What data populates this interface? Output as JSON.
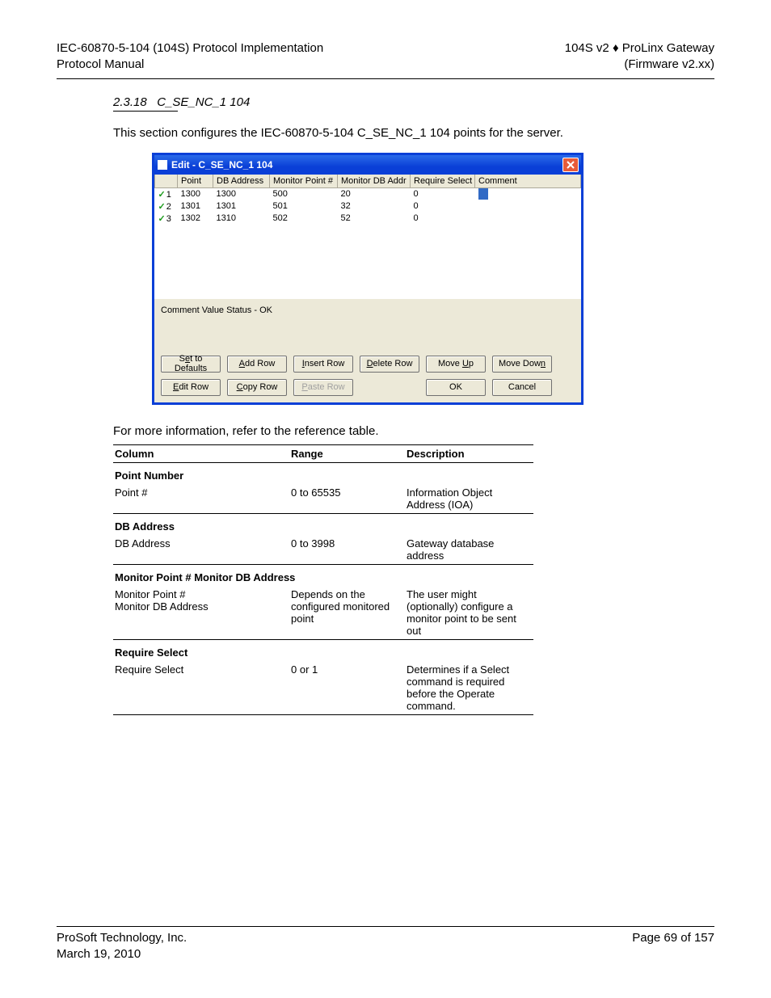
{
  "header": {
    "left1": "IEC-60870-5-104 (104S) Protocol Implementation",
    "left2": "Protocol Manual",
    "right1": "104S v2 ♦ ProLinx Gateway",
    "right2": "(Firmware v2.xx)"
  },
  "section": {
    "number": "2.3.18",
    "title": "C_SE_NC_1 104",
    "intro": "This section configures the IEC-60870-5-104 C_SE_NC_1 104 points for the server."
  },
  "dialog": {
    "title": "Edit - C_SE_NC_1 104",
    "columns": [
      "",
      "Point",
      "DB Address",
      "Monitor Point #",
      "Monitor DB Addr",
      "Require Select",
      "Comment"
    ],
    "rows": [
      {
        "n": "1",
        "point": "1300",
        "db": "1300",
        "mpt": "500",
        "mdb": "20",
        "req": "0"
      },
      {
        "n": "2",
        "point": "1301",
        "db": "1301",
        "mpt": "501",
        "mdb": "32",
        "req": "0"
      },
      {
        "n": "3",
        "point": "1302",
        "db": "1310",
        "mpt": "502",
        "mdb": "52",
        "req": "0"
      }
    ],
    "status": "Comment Value Status - OK",
    "buttons": {
      "set_defaults_pre": "S",
      "set_defaults_u": "e",
      "set_defaults_post": "t to Defaults",
      "add_row_u": "A",
      "add_row_post": "dd Row",
      "insert_row_u": "I",
      "insert_row_post": "nsert Row",
      "delete_row_u": "D",
      "delete_row_post": "elete Row",
      "move_up_pre": "Move ",
      "move_up_u": "U",
      "move_up_post": "p",
      "move_down_pre": "Move Dow",
      "move_down_u": "n",
      "edit_row_u": "E",
      "edit_row_post": "dit Row",
      "copy_row_u": "C",
      "copy_row_post": "opy Row",
      "paste_row_u": "P",
      "paste_row_post": "aste Row",
      "ok": "OK",
      "cancel": "Cancel"
    }
  },
  "reference": {
    "intro": "For more information, refer to the reference table.",
    "headers": {
      "c1": "Column",
      "c2": "Range",
      "c3": "Description"
    },
    "section1_title": "Point Number",
    "row1": {
      "c1": "Point #",
      "c2": "0 to 65535",
      "c3": "Information Object Address (IOA)"
    },
    "section2_title": "DB Address",
    "row2": {
      "c1": "DB Address",
      "c2": "0 to 3998",
      "c3": "Gateway database address"
    },
    "section3_title": "Monitor Point # Monitor DB Address",
    "row3": {
      "c1": "Monitor Point #\nMonitor DB Address",
      "c2": "Depends on the configured monitored point",
      "c3": "The user might (optionally) configure a monitor point to be sent out"
    },
    "section4_title": "Require Select",
    "row4": {
      "c1": "Require Select",
      "c2": "0 or 1",
      "c3": "Determines if a Select command is required before the Operate command."
    }
  },
  "footer": {
    "company": "ProSoft Technology, Inc.",
    "date": "March 19, 2010",
    "page": "Page 69 of 157"
  }
}
